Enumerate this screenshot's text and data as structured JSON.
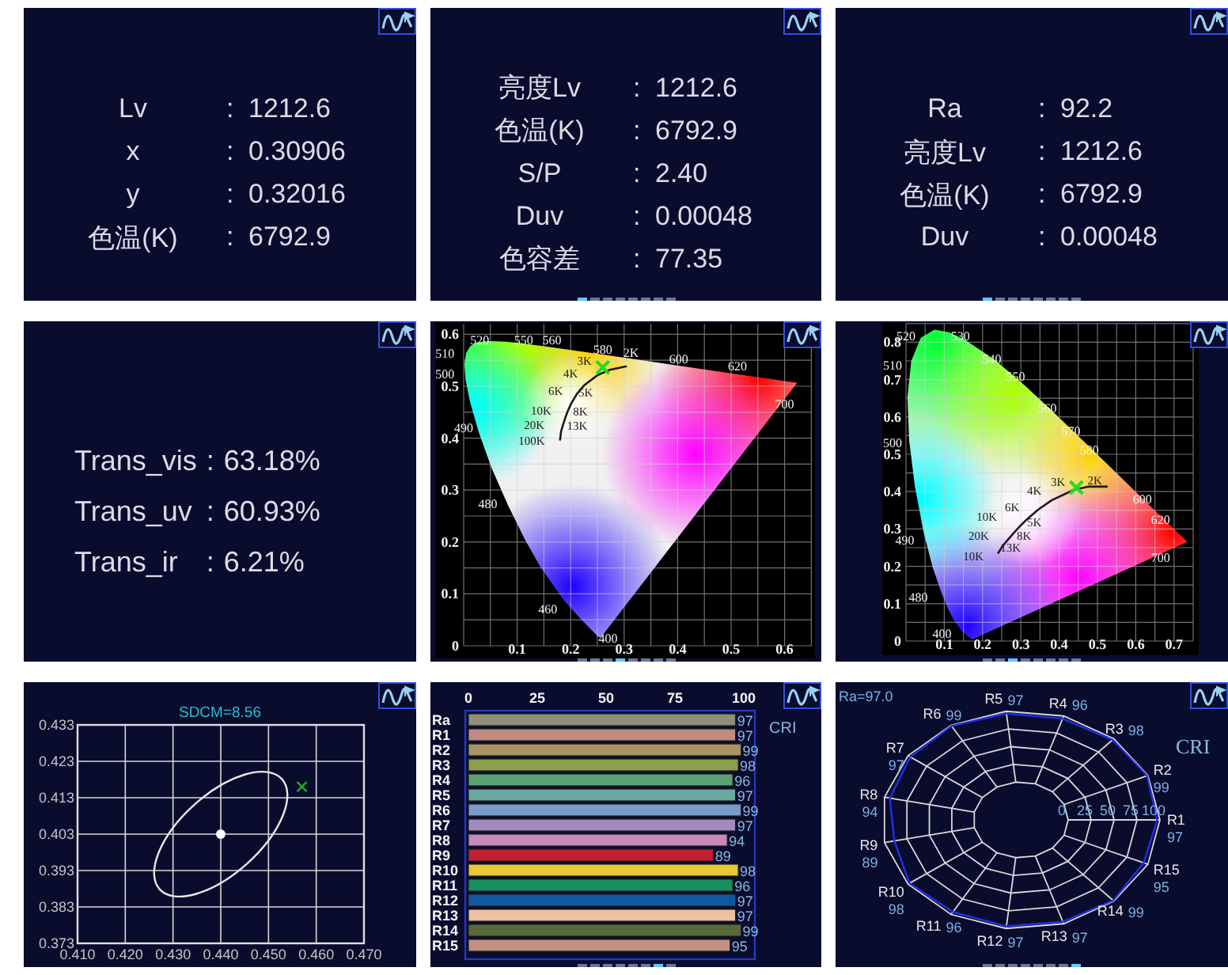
{
  "panels": [
    {
      "kind": "readings",
      "rows": [
        {
          "label": "Lv",
          "colon": ":",
          "value": "1212.6"
        },
        {
          "label": "x",
          "colon": ":",
          "value": "0.30906"
        },
        {
          "label": "y",
          "colon": ":",
          "value": "0.32016"
        },
        {
          "label": "色温(K)",
          "colon": ":",
          "value": "6792.9"
        }
      ]
    },
    {
      "kind": "readings",
      "rows": [
        {
          "label": "亮度Lv",
          "colon": ":",
          "value": "1212.6"
        },
        {
          "label": "色温(K)",
          "colon": ":",
          "value": "6792.9"
        },
        {
          "label": "S/P",
          "colon": ":",
          "value": "2.40"
        },
        {
          "label": "Duv",
          "colon": ":",
          "value": "0.00048"
        },
        {
          "label": "色容差",
          "colon": ":",
          "value": "77.35"
        }
      ],
      "pager": [
        {
          "selected": true
        },
        {
          "selected": false
        },
        {
          "selected": false
        },
        {
          "selected": false
        },
        {
          "selected": false
        },
        {
          "selected": false
        },
        {
          "selected": false
        },
        {
          "selected": false
        }
      ]
    },
    {
      "kind": "readings",
      "rows": [
        {
          "label": "Ra",
          "colon": ":",
          "value": "92.2"
        },
        {
          "label": "亮度Lv",
          "colon": ":",
          "value": "1212.6"
        },
        {
          "label": "色温(K)",
          "colon": ":",
          "value": "6792.9"
        },
        {
          "label": "Duv",
          "colon": ":",
          "value": "0.00048"
        }
      ],
      "pager": [
        {
          "selected": true
        },
        {
          "selected": false
        },
        {
          "selected": false
        },
        {
          "selected": false
        },
        {
          "selected": false
        },
        {
          "selected": false
        },
        {
          "selected": false
        },
        {
          "selected": false
        }
      ]
    },
    {
      "kind": "transmission",
      "rows": [
        {
          "label": "Trans_vis",
          "colon": ":",
          "value": "63.18%"
        },
        {
          "label": "Trans_uv",
          "colon": ":",
          "value": "60.93%"
        },
        {
          "label": "Trans_ir",
          "colon": ":",
          "value": "6.21%"
        }
      ]
    },
    {
      "kind": "cie_uv",
      "pager": [
        {
          "selected": false
        },
        {
          "selected": false
        },
        {
          "selected": false
        },
        {
          "selected": true
        },
        {
          "selected": false
        },
        {
          "selected": false
        },
        {
          "selected": false
        },
        {
          "selected": false
        }
      ],
      "wavelength_labels": [
        "520",
        "550",
        "560",
        "580",
        "600",
        "620",
        "700",
        "510",
        "500",
        "490",
        "480",
        "460",
        "400"
      ],
      "cct_labels": [
        "2K",
        "3K",
        "4K",
        "6K",
        "5K",
        "10K",
        "8K",
        "20K",
        "13K",
        "100K"
      ],
      "chart_data": {
        "type": "scatter",
        "grid": true,
        "xlim": [
          0,
          0.65
        ],
        "ylim": [
          0,
          0.62
        ],
        "xticks": [
          0.1,
          0.2,
          0.3,
          0.4,
          0.5,
          0.6
        ],
        "yticks": [
          0,
          0.1,
          0.2,
          0.3,
          0.4,
          0.5,
          0.6
        ],
        "x": [
          0.26
        ],
        "series": [
          {
            "color": "#22dd22",
            "values": [
              0.536
            ]
          }
        ]
      }
    },
    {
      "kind": "cie_xy",
      "pager": [
        {
          "selected": false
        },
        {
          "selected": false
        },
        {
          "selected": true
        },
        {
          "selected": false
        },
        {
          "selected": false
        },
        {
          "selected": false
        },
        {
          "selected": false
        },
        {
          "selected": false
        }
      ],
      "wavelength_labels": [
        "520",
        "530",
        "540",
        "550",
        "560",
        "570",
        "580",
        "600",
        "620",
        "700",
        "510",
        "500",
        "490",
        "480",
        "400"
      ],
      "cct_labels": [
        "3K",
        "2K",
        "4K",
        "6K",
        "10K",
        "5K",
        "8K",
        "20K",
        "13K",
        "10K"
      ],
      "chart_data": {
        "type": "scatter",
        "grid": true,
        "xlim": [
          0,
          0.75
        ],
        "ylim": [
          0,
          0.85
        ],
        "xticks": [
          0.1,
          0.2,
          0.3,
          0.4,
          0.5,
          0.6,
          0.7
        ],
        "yticks": [
          0,
          0.1,
          0.2,
          0.3,
          0.4,
          0.5,
          0.6,
          0.7,
          0.8
        ],
        "x": [
          0.445
        ],
        "series": [
          {
            "color": "#22dd22",
            "values": [
              0.411
            ]
          }
        ]
      }
    },
    {
      "kind": "sdcm",
      "chart_data": {
        "type": "scatter",
        "grid": true,
        "title": "SDCM=8.56",
        "xlim": [
          0.41,
          0.47
        ],
        "ylim": [
          0.373,
          0.433
        ],
        "xticks": [
          {
            "value": 0.41,
            "label": "0.410"
          },
          {
            "value": 0.42,
            "label": "0.420"
          },
          {
            "value": 0.43,
            "label": "0.430"
          },
          {
            "value": 0.44,
            "label": "0.440"
          },
          {
            "value": 0.45,
            "label": "0.450"
          },
          {
            "value": 0.46,
            "label": "0.460"
          },
          {
            "value": 0.47,
            "label": "0.470"
          }
        ],
        "yticks": [
          {
            "value": 0.373,
            "label": "0.373"
          },
          {
            "value": 0.383,
            "label": "0.383"
          },
          {
            "value": 0.393,
            "label": "0.393"
          },
          {
            "value": 0.403,
            "label": "0.403"
          },
          {
            "value": 0.413,
            "label": "0.413"
          },
          {
            "value": 0.423,
            "label": "0.423"
          },
          {
            "value": 0.433,
            "label": "0.433"
          }
        ],
        "x": [
          0.44,
          0.457
        ],
        "series": [
          {
            "color": "#ffffff",
            "values": [
              0.403,
              null
            ]
          },
          {
            "color": "#22aa22",
            "values": [
              null,
              0.416
            ]
          }
        ]
      }
    },
    {
      "kind": "cri_bars",
      "legend": "CRI",
      "pager": [
        {
          "selected": false
        },
        {
          "selected": false
        },
        {
          "selected": false
        },
        {
          "selected": false
        },
        {
          "selected": false
        },
        {
          "selected": false
        },
        {
          "selected": true
        },
        {
          "selected": false
        }
      ],
      "chart_data": {
        "type": "bar",
        "orientation": "horizontal",
        "xticks": [
          0,
          25,
          50,
          75,
          100
        ],
        "xlim": [
          0,
          104
        ],
        "data_labels": true,
        "categories": [
          "Ra",
          "R1",
          "R2",
          "R3",
          "R4",
          "R5",
          "R6",
          "R7",
          "R8",
          "R9",
          "R10",
          "R11",
          "R12",
          "R13",
          "R14",
          "R15"
        ],
        "colors": [
          "#8f8e7a",
          "#c08a80",
          "#a89464",
          "#8aa04a",
          "#5aa070",
          "#6aa8a0",
          "#7a9ccc",
          "#a08cc0",
          "#c88ab8",
          "#c02030",
          "#e8c838",
          "#189060",
          "#1058a0",
          "#ecc0a0",
          "#586838",
          "#c09080"
        ],
        "series": [
          {
            "values": [
              97,
              97,
              99,
              98,
              96,
              97,
              99,
              97,
              94,
              89,
              98,
              96,
              97,
              97,
              99,
              95
            ]
          }
        ]
      }
    },
    {
      "kind": "cri_radar",
      "summary": "Ra=97.0",
      "legend": "CRI",
      "rings": [
        "0",
        "25",
        "50",
        "75",
        "100"
      ],
      "pager": [
        {
          "selected": false
        },
        {
          "selected": false
        },
        {
          "selected": false
        },
        {
          "selected": false
        },
        {
          "selected": false
        },
        {
          "selected": false
        },
        {
          "selected": false
        },
        {
          "selected": true
        }
      ],
      "axes": [
        {
          "label": "R1",
          "value": "97"
        },
        {
          "label": "R2",
          "value": "99"
        },
        {
          "label": "R3",
          "value": "98"
        },
        {
          "label": "R4",
          "value": "96"
        },
        {
          "label": "R5",
          "value": "97"
        },
        {
          "label": "R6",
          "value": "99"
        },
        {
          "label": "R7",
          "value": "97"
        },
        {
          "label": "R8",
          "value": "94"
        },
        {
          "label": "R9",
          "value": "89"
        },
        {
          "label": "R10",
          "value": "98"
        },
        {
          "label": "R11",
          "value": "96"
        },
        {
          "label": "R12",
          "value": "97"
        },
        {
          "label": "R13",
          "value": "97"
        },
        {
          "label": "R14",
          "value": "99"
        },
        {
          "label": "R15",
          "value": "95"
        }
      ]
    }
  ]
}
